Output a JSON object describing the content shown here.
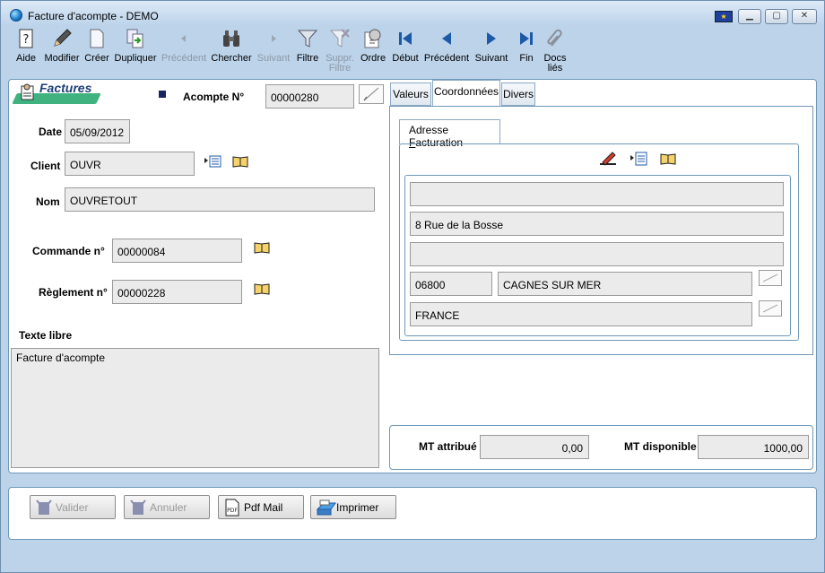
{
  "window": {
    "title": "Facture d'acompte - DEMO"
  },
  "toolbar": {
    "items": [
      {
        "label": "Aide",
        "icon": "help-icon"
      },
      {
        "label": "Modifier",
        "icon": "pencil-icon"
      },
      {
        "label": "Créer",
        "icon": "new-page-icon"
      },
      {
        "label": "Dupliquer",
        "icon": "duplicate-icon"
      },
      {
        "label": "Précédent",
        "icon": "small-left-arrow-icon"
      },
      {
        "label": "Chercher",
        "icon": "binoculars-icon"
      },
      {
        "label": "Suivant",
        "icon": "small-right-arrow-icon"
      },
      {
        "label": "Filtre",
        "icon": "funnel-icon"
      },
      {
        "label": "Suppr.",
        "label2": "Filtre",
        "icon": "remove-filter-icon"
      },
      {
        "label": "Ordre",
        "icon": "sort-order-icon"
      },
      {
        "label": "Début",
        "icon": "first-record-icon"
      },
      {
        "label": "Précédent",
        "icon": "previous-record-icon"
      },
      {
        "label": "Suivant",
        "icon": "next-record-icon"
      },
      {
        "label": "Fin",
        "icon": "last-record-icon"
      },
      {
        "label": "Docs",
        "label2": "liés",
        "icon": "paperclip-icon"
      }
    ]
  },
  "header": {
    "section": "Factures",
    "acompte_label": "Acompte N°",
    "acompte_value": "00000280"
  },
  "form": {
    "date_label": "Date",
    "date_value": "05/09/2012",
    "client_label": "Client",
    "client_value": "OUVR",
    "nom_label": "Nom",
    "nom_value": "OUVRETOUT",
    "commande_label": "Commande n°",
    "commande_value": "00000084",
    "reglement_label": "Règlement n°",
    "reglement_value": "00000228",
    "texte_label": "Texte libre",
    "texte_value": "Facture d'acompte"
  },
  "tabs": [
    "Valeurs",
    "Coordonnées",
    "Divers"
  ],
  "address": {
    "subtab_prefix": "Adresse ",
    "subtab_underlined": "F",
    "subtab_rest": "acturation",
    "line1": "",
    "line2": "8 Rue de la Bosse",
    "line3": "",
    "postcode": "06800",
    "city": "CAGNES SUR MER",
    "country": "FRANCE"
  },
  "totals": {
    "attribue_label": "MT attribué",
    "attribue_value": "0,00",
    "disponible_label": "MT disponible",
    "disponible_value": "1000,00"
  },
  "buttons": {
    "valider": "Valider",
    "annuler": "Annuler",
    "pdfmail": "Pdf Mail",
    "imprimer": "Imprimer"
  },
  "colors": {
    "panel_border": "#6f98ba",
    "window_bg": "#bcd3ea",
    "field_bg": "#ebebeb",
    "section_title": "#1f3f7a"
  }
}
